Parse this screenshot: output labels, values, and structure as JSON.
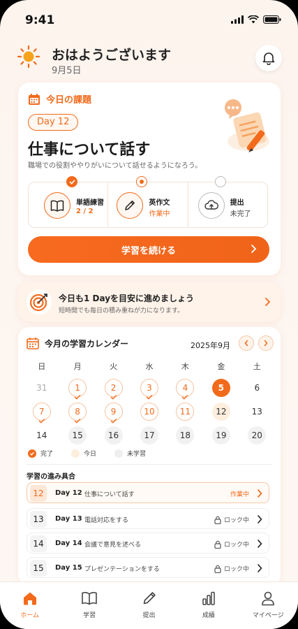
{
  "status": {
    "time": "9:41"
  },
  "header": {
    "greeting": "おはようございます",
    "date": "9月5日"
  },
  "task": {
    "section_label": "今日の課題",
    "day": "Day 12",
    "title": "仕事について話す",
    "subtitle": "職場での役割ややりがいについて話せるようになろう。",
    "steps": [
      {
        "label": "単語練習",
        "value": "2 / 2",
        "state": "done",
        "icon": "book-icon"
      },
      {
        "label": "英作文",
        "value": "作業中",
        "state": "active",
        "icon": "pencil-icon"
      },
      {
        "label": "提出",
        "value": "未完了",
        "state": "todo",
        "icon": "cloud-upload-icon"
      }
    ],
    "continue_label": "学習を続ける"
  },
  "goal": {
    "title": "今日も1 Dayを目安に進めましょう",
    "subtitle": "短時間でも毎日の積み重ねが力になります。"
  },
  "calendar": {
    "title": "今月の学習カレンダー",
    "month": "2025年9月",
    "weekdays": [
      "日",
      "月",
      "火",
      "水",
      "木",
      "金",
      "土"
    ],
    "weeks": [
      [
        [
          "31",
          "grey"
        ],
        [
          "1",
          "done"
        ],
        [
          "2",
          "done"
        ],
        [
          "3",
          "done"
        ],
        [
          "4",
          "done"
        ],
        [
          "5",
          "today"
        ],
        [
          "6",
          "plain"
        ]
      ],
      [
        [
          "7",
          "done"
        ],
        [
          "8",
          "done"
        ],
        [
          "9",
          "done"
        ],
        [
          "10",
          "wkdone"
        ],
        [
          "11",
          "wkdone"
        ],
        [
          "12",
          "wk"
        ],
        [
          "13",
          "plain"
        ]
      ],
      [
        [
          "14",
          "plain"
        ],
        [
          "15",
          "fut"
        ],
        [
          "16",
          "fut"
        ],
        [
          "17",
          "fut"
        ],
        [
          "18",
          "fut"
        ],
        [
          "19",
          "fut"
        ],
        [
          "20",
          "fut"
        ]
      ]
    ],
    "legend": {
      "done": "完了",
      "today": "今日",
      "todo": "未学習"
    },
    "progress_title": "学習の進み具合",
    "rows": [
      {
        "num": "12",
        "day": "Day 12",
        "name": "仕事について話す",
        "status": "作業中",
        "active": true
      },
      {
        "num": "13",
        "day": "Day 13",
        "name": "電話対応をする",
        "status": "ロック中",
        "active": false
      },
      {
        "num": "14",
        "day": "Day 14",
        "name": "会議で意見を述べる",
        "status": "ロック中",
        "active": false
      },
      {
        "num": "15",
        "day": "Day 15",
        "name": "プレゼンテーションをする",
        "status": "ロック中",
        "active": false
      }
    ]
  },
  "tabs": [
    {
      "label": "ホーム",
      "icon": "home-icon",
      "active": true
    },
    {
      "label": "学習",
      "icon": "book-icon",
      "active": false
    },
    {
      "label": "提出",
      "icon": "pencil-icon",
      "active": false
    },
    {
      "label": "成績",
      "icon": "bar-chart-icon",
      "active": false
    },
    {
      "label": "マイページ",
      "icon": "person-icon",
      "active": false
    }
  ],
  "colors": {
    "accent": "#f26a1b",
    "background": "#fdf4ee"
  }
}
